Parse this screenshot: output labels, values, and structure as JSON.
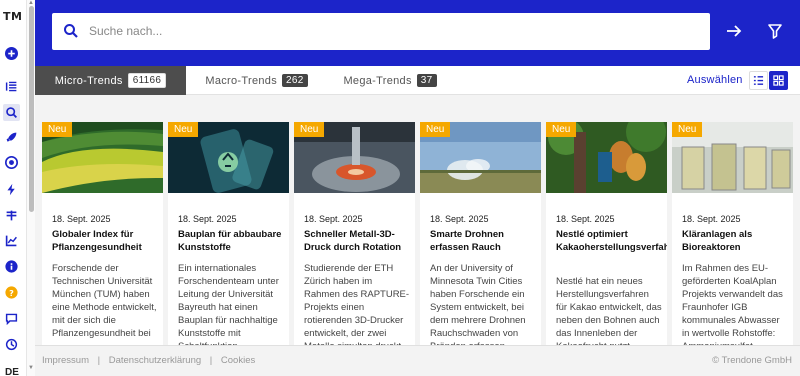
{
  "sidebar": {
    "logo": "TM",
    "language": "DE",
    "icons": [
      "plus-circle-icon",
      "list-icon",
      "search-icon",
      "rocket-icon",
      "target-icon",
      "bolt-icon",
      "filter-lines-icon",
      "chart-icon",
      "info-icon",
      "help-icon",
      "chat-icon",
      "history-icon"
    ]
  },
  "header": {
    "search_placeholder": "Suche nach..."
  },
  "tabs": [
    {
      "label": "Micro-Trends",
      "count": "61166",
      "active": true
    },
    {
      "label": "Macro-Trends",
      "count": "262",
      "active": false
    },
    {
      "label": "Mega-Trends",
      "count": "37",
      "active": false
    }
  ],
  "toolbar": {
    "select_label": "Auswählen"
  },
  "cards": [
    {
      "badge": "Neu",
      "date": "18. Sept. 2025",
      "title": "Globaler Index für Pflanzengesundheit",
      "description": "Forschende der Technischen Universität München (TUM) haben eine Methode entwickelt, mit der sich die Pflanzengesundheit bei"
    },
    {
      "badge": "Neu",
      "date": "18. Sept. 2025",
      "title": "Bauplan für abbaubare Kunststoffe",
      "description": "Ein internationales Forschendenteam unter Leitung der Universität Bayreuth hat einen Bauplan für nachhaltige Kunststoffe mit Schaltfunktion"
    },
    {
      "badge": "Neu",
      "date": "18. Sept. 2025",
      "title": "Schneller Metall-3D-Druck durch Rotation",
      "description": "Studierende der ETH Zürich haben im Rahmen des RAPTURE-Projekts einen rotierenden 3D-Drucker entwickelt, der zwei Metalle simultan druckt"
    },
    {
      "badge": "Neu",
      "date": "18. Sept. 2025",
      "title": "Smarte Drohnen erfassen Rauch",
      "description": "An der University of Minnesota Twin Cities haben Forschende ein System entwickelt, bei dem mehrere Drohnen Rauchschwaden von Bränden erfassen"
    },
    {
      "badge": "Neu",
      "date": "18. Sept. 2025",
      "title": "Nestlé optimiert Kakaoherstellungsverfahren",
      "description": "Nestlé hat ein neues Herstellungsverfahren für Kakao entwickelt, das neben den Bohnen auch das Innenleben der Kakaofrucht nutzt"
    },
    {
      "badge": "Neu",
      "date": "18. Sept. 2025",
      "title": "Kläranlagen als Bioreaktoren",
      "description": "Im Rahmen des EU-geförderten KoalAplan Projekts verwandelt das Fraunhofer IGB kommunales Abwasser in wertvolle Rohstoffe: Ammoniumsulfat"
    }
  ],
  "footer": {
    "links": [
      "Impressum",
      "Datenschutzerklärung",
      "Cookies"
    ],
    "copyright": "© Trendone GmbH"
  },
  "colors": {
    "brand_blue": "#1c24c9",
    "badge_orange": "#f5a800",
    "active_tab": "#4d4d4d"
  }
}
